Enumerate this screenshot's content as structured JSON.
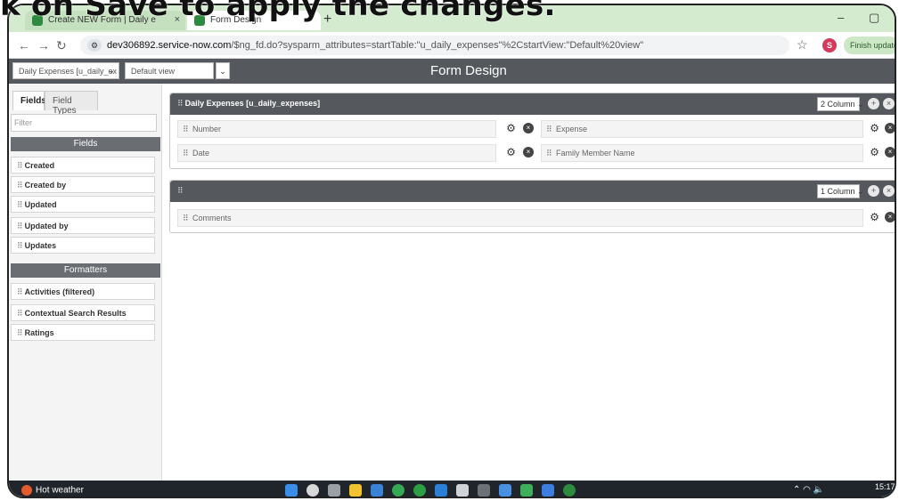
{
  "caption": "k on Save to apply the changes.",
  "colors": {
    "tabbar": "#d4ebd0",
    "app_header": "#55595e",
    "section_header": "#6a6d72",
    "accent_green": "#2d8a3e",
    "taskbar": "#20252b"
  },
  "browser": {
    "tabs": [
      {
        "label": "Create NEW Form | Daily e",
        "icon": "servicenow-favicon"
      },
      {
        "label": "Form Design",
        "icon": "servicenow-favicon"
      }
    ],
    "new_tab": "+",
    "window_controls": {
      "minimize": "–",
      "restore": "▢"
    },
    "url_host": "dev306892.service-now.com",
    "url_path": "/$ng_fd.do?sysparm_attributes=startTable:\"u_daily_expenses\"%2CstartView:\"Default%20view\"",
    "profile_initial": "S",
    "finish_update": "Finish update"
  },
  "form_design": {
    "table_select": "Daily Expenses [u_daily_ex",
    "view_select": "Default view",
    "title": "Form Design"
  },
  "left_pane": {
    "tabs": {
      "fields": "Fields",
      "field_types": "Field Types"
    },
    "filter_placeholder": "Filter",
    "fields_header": "Fields",
    "fields": [
      "Created",
      "Created by",
      "Updated",
      "Updated by",
      "Updates"
    ],
    "formatters_header": "Formatters",
    "formatters": [
      "Activities (filtered)",
      "Contextual Search Results",
      "Ratings"
    ]
  },
  "sections": {
    "first": {
      "title": "Daily Expenses [u_daily_expenses]",
      "columns": "2 Column",
      "fields": {
        "left": [
          "Number",
          "Date"
        ],
        "right": [
          "Expense",
          "Family Member Name"
        ]
      }
    },
    "second": {
      "title": "",
      "columns": "1 Column",
      "fields": [
        "Comments"
      ]
    }
  },
  "taskbar": {
    "weather": "Hot weather",
    "clock": "15:17"
  }
}
